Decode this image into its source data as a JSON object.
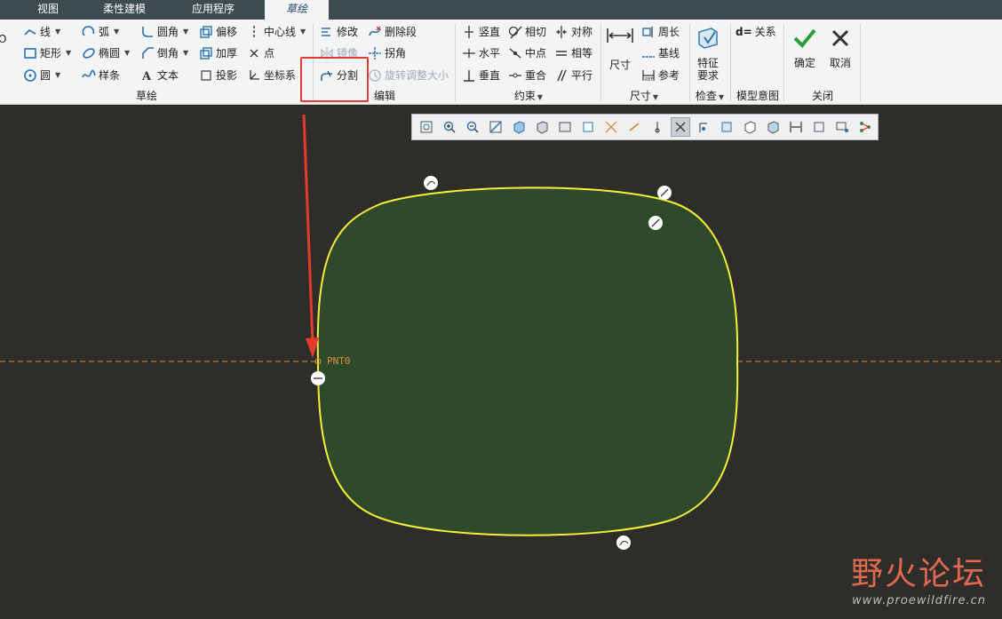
{
  "tabs": [
    "视图",
    "柔性建模",
    "应用程序",
    "草绘"
  ],
  "left_cut": {
    "top": "O",
    "mid": "5"
  },
  "sketch_group": {
    "label": "草绘",
    "items": {
      "line": "线",
      "rect": "矩形",
      "circle": "圆",
      "arc": "弧",
      "ellipse": "椭圆",
      "spline": "样条",
      "fillet": "圆角",
      "chamfer": "倒角",
      "text": "文本",
      "offset": "偏移",
      "thicken": "加厚",
      "project": "投影",
      "centerline": "中心线",
      "point": "点",
      "coordsys": "坐标系"
    }
  },
  "edit_group": {
    "label": "编辑",
    "items": {
      "modify": "修改",
      "mirror": "镜像",
      "divide": "分割",
      "delete_segment": "删除段",
      "corner": "拐角",
      "rotate_resize": "旋转调整大小"
    }
  },
  "constraint_group": {
    "label": "约束",
    "items": {
      "vertical": "竖直",
      "horizontal": "水平",
      "perpendicular": "垂直",
      "tangent": "相切",
      "midpoint": "中点",
      "coincident": "重合",
      "symmetric": "对称",
      "equal": "相等",
      "parallel": "平行"
    }
  },
  "dimension_group": {
    "label": "尺寸",
    "items": {
      "dimension": "尺寸",
      "perimeter": "周长",
      "baseline": "基线",
      "reference": "参考"
    }
  },
  "inspect_group": {
    "label": "检查",
    "feature_req_1": "特征",
    "feature_req_2": "要求"
  },
  "model_intent_group": {
    "label": "模型意图",
    "relations": "关系"
  },
  "close_group": {
    "label": "关闭",
    "ok": "确定",
    "cancel": "取消"
  },
  "canvas": {
    "axis_label": "PNT0"
  },
  "watermark": {
    "title": "野火论坛",
    "url": "www.proewildfire.cn"
  },
  "colors": {
    "highlight": "#e53a2e",
    "sketch_line": "#f4ef3a",
    "sketch_fill": "#2f4a2a",
    "canvas_bg": "#2f2d29",
    "axis": "#d98a3a"
  }
}
